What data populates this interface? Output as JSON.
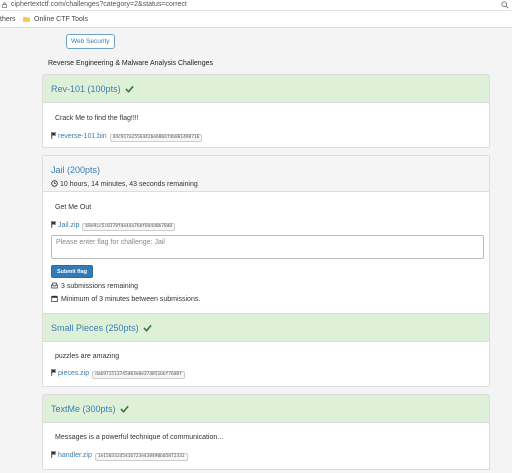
{
  "browser": {
    "url": "ciphertextctf.com/challenges?category=2&status=correct",
    "bookmarks": {
      "others_label": "thers",
      "folder_label": "Online CTF Tools"
    }
  },
  "category": {
    "button_label": "Web Security",
    "heading": "Reverse Engineering & Malware Analysis Challenges"
  },
  "challenges": [
    {
      "name": "Rev-101",
      "points": "(100pts)",
      "solved": true,
      "description": "Crack Me to find the flag!!!!",
      "file_name": "reverse-101.bin",
      "file_hash": "44c917a2556442beb0b6f4b801498716"
    },
    {
      "name": "Jail",
      "points": "(200pts)",
      "solved": false,
      "timer": "10 hours, 14 minutes, 43 seconds remaining",
      "description": "Get Me Out",
      "file_name": "Jail.zip",
      "file_hash": "b8e9cc5c0178fde4da7bbf8d4d0b78d0",
      "flag_placeholder": "Please enter flag for challenge: Jail",
      "submit_label": "Submit flag",
      "submissions_remaining": "3 submissions remaining",
      "min_interval": "Minimum of 3 minutes between submissions."
    },
    {
      "name": "Small Pieces",
      "points": "(250pts)",
      "solved": true,
      "description": "puzzles are amazing",
      "file_name": "pieces.zip",
      "file_hash": "da6971513745d03e0e374851bbf76d0f"
    },
    {
      "name": "TextMe",
      "points": "(300pts)",
      "solved": true,
      "description": "Messages is a powerful technique of communication...",
      "file_name": "handler.zip",
      "file_hash": "1e150332d5416723e438490b05872332"
    }
  ],
  "icons": {
    "check": "check-icon",
    "flag": "flag-icon",
    "clock": "clock-icon",
    "inbox": "inbox-icon",
    "calendar": "calendar-icon"
  },
  "colors": {
    "solved_header": "#dff0d8",
    "open_header": "#f5f5f5",
    "link": "#3a7eb0",
    "check": "#3c763d",
    "submit": "#337ab7"
  }
}
